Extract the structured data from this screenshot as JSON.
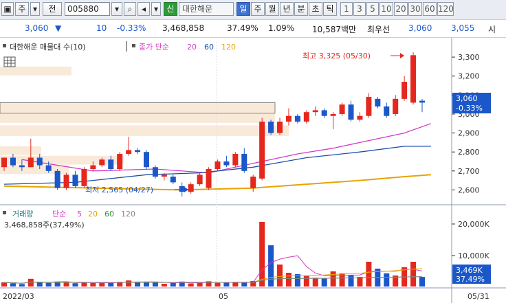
{
  "toolbar": {
    "mode_label": "주",
    "jeon_label": "전",
    "code_value": "005880",
    "shin_label": "신",
    "stock_name": "대한해운",
    "period_tabs": [
      "일",
      "주",
      "월",
      "년",
      "분",
      "초",
      "틱"
    ],
    "interval_tabs": [
      "1",
      "3",
      "5",
      "10",
      "20",
      "30",
      "60",
      "120"
    ],
    "active_period": "일"
  },
  "quote": {
    "price": "3,060",
    "change": "10",
    "change_pct": "-0.33%",
    "volume": "3,468,858",
    "vol_ratio": "37.49%",
    "turnover": "1.09%",
    "amount": "10,587백만",
    "best_label": "최우선",
    "best_sell": "3,060",
    "best_buy": "3,055",
    "extra": "시"
  },
  "price_legend": {
    "title": "대한해운 매물대 수(10)",
    "ma_label": "종가 단순",
    "ma_periods": [
      "20",
      "60",
      "120"
    ]
  },
  "annotations": {
    "high": "최고 3,325 (05/30)",
    "low": "최저 2,565 (04/27)"
  },
  "price_axis": {
    "ticks": [
      "3,300",
      "3,200",
      "3,100",
      "3,000",
      "2,900",
      "2,800",
      "2,700",
      "2,600"
    ],
    "current_price": "3,060",
    "current_pct": "-0.33%"
  },
  "volume_legend": {
    "title": "거래량",
    "ma_label": "단순",
    "ma_periods": [
      "5",
      "20",
      "60",
      "120"
    ],
    "summary": "3,468,858주(37,49%)"
  },
  "volume_axis": {
    "ticks": [
      "20,000K",
      "10,000K"
    ],
    "current_volume": "3,469K",
    "current_pct": "37.49%"
  },
  "date_axis": {
    "labels": [
      "2022/03",
      "05",
      "05/31"
    ]
  },
  "colors": {
    "up": "#e4281e",
    "down": "#1b57c9",
    "ma20": "#d23ac8",
    "ma60": "#1a4fa8",
    "ma120": "#e8a300"
  },
  "chart_data": {
    "type": "candlestick",
    "price_range": [
      2540,
      3380
    ],
    "volume_range": [
      0,
      25000
    ],
    "volume_unit": "K",
    "candles": [
      {
        "o": 2720,
        "h": 2770,
        "l": 2700,
        "c": 2770,
        "v": 1500
      },
      {
        "o": 2770,
        "h": 2790,
        "l": 2720,
        "c": 2730,
        "v": 1200
      },
      {
        "o": 2730,
        "h": 2760,
        "l": 2700,
        "c": 2720,
        "v": 900
      },
      {
        "o": 2720,
        "h": 2870,
        "l": 2720,
        "c": 2770,
        "v": 2800
      },
      {
        "o": 2770,
        "h": 2790,
        "l": 2710,
        "c": 2730,
        "v": 1600
      },
      {
        "o": 2730,
        "h": 2750,
        "l": 2690,
        "c": 2700,
        "v": 1300
      },
      {
        "o": 2700,
        "h": 2710,
        "l": 2600,
        "c": 2610,
        "v": 1800
      },
      {
        "o": 2610,
        "h": 2690,
        "l": 2600,
        "c": 2680,
        "v": 1400
      },
      {
        "o": 2680,
        "h": 2700,
        "l": 2610,
        "c": 2620,
        "v": 1200
      },
      {
        "o": 2620,
        "h": 2720,
        "l": 2610,
        "c": 2710,
        "v": 1500
      },
      {
        "o": 2710,
        "h": 2750,
        "l": 2700,
        "c": 2730,
        "v": 1300
      },
      {
        "o": 2730,
        "h": 2770,
        "l": 2720,
        "c": 2760,
        "v": 1400
      },
      {
        "o": 2760,
        "h": 2780,
        "l": 2700,
        "c": 2710,
        "v": 1500
      },
      {
        "o": 2710,
        "h": 2800,
        "l": 2700,
        "c": 2790,
        "v": 1700
      },
      {
        "o": 2790,
        "h": 2880,
        "l": 2780,
        "c": 2810,
        "v": 2200
      },
      {
        "o": 2810,
        "h": 2820,
        "l": 2790,
        "c": 2800,
        "v": 1400
      },
      {
        "o": 2800,
        "h": 2810,
        "l": 2710,
        "c": 2720,
        "v": 1600
      },
      {
        "o": 2720,
        "h": 2730,
        "l": 2660,
        "c": 2670,
        "v": 1500
      },
      {
        "o": 2670,
        "h": 2690,
        "l": 2650,
        "c": 2680,
        "v": 1000
      },
      {
        "o": 2670,
        "h": 2680,
        "l": 2630,
        "c": 2640,
        "v": 1300
      },
      {
        "o": 2620,
        "h": 2640,
        "l": 2565,
        "c": 2590,
        "v": 1800
      },
      {
        "o": 2590,
        "h": 2640,
        "l": 2580,
        "c": 2630,
        "v": 1100
      },
      {
        "o": 2630,
        "h": 2690,
        "l": 2620,
        "c": 2680,
        "v": 1500
      },
      {
        "o": 2610,
        "h": 2720,
        "l": 2600,
        "c": 2710,
        "v": 1900
      },
      {
        "o": 2710,
        "h": 2760,
        "l": 2700,
        "c": 2750,
        "v": 1300
      },
      {
        "o": 2750,
        "h": 2780,
        "l": 2720,
        "c": 2730,
        "v": 1400
      },
      {
        "o": 2730,
        "h": 2800,
        "l": 2720,
        "c": 2790,
        "v": 1700
      },
      {
        "o": 2790,
        "h": 2820,
        "l": 2690,
        "c": 2700,
        "v": 1400
      },
      {
        "o": 2610,
        "h": 2680,
        "l": 2590,
        "c": 2670,
        "v": 2000
      },
      {
        "o": 2660,
        "h": 2980,
        "l": 2650,
        "c": 2960,
        "v": 23500
      },
      {
        "o": 2960,
        "h": 2970,
        "l": 2890,
        "c": 2900,
        "v": 15000
      },
      {
        "o": 2900,
        "h": 2980,
        "l": 2890,
        "c": 2960,
        "v": 8000
      },
      {
        "o": 2960,
        "h": 3030,
        "l": 2940,
        "c": 2990,
        "v": 5000
      },
      {
        "o": 2990,
        "h": 3000,
        "l": 2950,
        "c": 2960,
        "v": 4500
      },
      {
        "o": 2960,
        "h": 3020,
        "l": 2950,
        "c": 3010,
        "v": 3800
      },
      {
        "o": 3010,
        "h": 3040,
        "l": 2990,
        "c": 3020,
        "v": 3200
      },
      {
        "o": 3020,
        "h": 3030,
        "l": 2980,
        "c": 2990,
        "v": 3000
      },
      {
        "o": 2990,
        "h": 3010,
        "l": 2920,
        "c": 3000,
        "v": 5500
      },
      {
        "o": 3000,
        "h": 3060,
        "l": 2990,
        "c": 3050,
        "v": 4800
      },
      {
        "o": 3050,
        "h": 3070,
        "l": 2960,
        "c": 2970,
        "v": 4200
      },
      {
        "o": 2970,
        "h": 3010,
        "l": 2960,
        "c": 2990,
        "v": 3500
      },
      {
        "o": 2990,
        "h": 3110,
        "l": 2980,
        "c": 3090,
        "v": 9000
      },
      {
        "o": 3080,
        "h": 3090,
        "l": 3030,
        "c": 3040,
        "v": 6500
      },
      {
        "o": 3040,
        "h": 3060,
        "l": 2980,
        "c": 2990,
        "v": 4800
      },
      {
        "o": 3000,
        "h": 3100,
        "l": 2990,
        "c": 3080,
        "v": 4000
      },
      {
        "o": 3080,
        "h": 3200,
        "l": 3070,
        "c": 3170,
        "v": 7000
      },
      {
        "o": 3060,
        "h": 3325,
        "l": 3050,
        "c": 3310,
        "v": 9000
      },
      {
        "o": 3070,
        "h": 3080,
        "l": 3010,
        "c": 3060,
        "v": 3469
      }
    ],
    "ma20": [
      [
        2,
        2760
      ],
      [
        10,
        2700
      ],
      [
        17,
        2710
      ],
      [
        23,
        2690
      ],
      [
        29,
        2750
      ],
      [
        33,
        2790
      ],
      [
        37,
        2820
      ],
      [
        41,
        2860
      ],
      [
        45,
        2900
      ],
      [
        48,
        2950
      ]
    ],
    "ma60": [
      [
        0,
        2630
      ],
      [
        8,
        2640
      ],
      [
        16,
        2680
      ],
      [
        22,
        2690
      ],
      [
        28,
        2720
      ],
      [
        34,
        2770
      ],
      [
        40,
        2800
      ],
      [
        45,
        2830
      ],
      [
        48,
        2830
      ]
    ],
    "ma120": [
      [
        0,
        2620
      ],
      [
        10,
        2610
      ],
      [
        20,
        2600
      ],
      [
        28,
        2610
      ],
      [
        34,
        2630
      ],
      [
        40,
        2650
      ],
      [
        45,
        2670
      ],
      [
        48,
        2680
      ]
    ],
    "supply_zones": [
      {
        "low": 3200,
        "high": 3250,
        "width": 0.26
      },
      {
        "low": 3000,
        "high": 3060,
        "width": 1.0
      },
      {
        "low": 2950,
        "high": 3000,
        "width": 1.0
      },
      {
        "low": 2880,
        "high": 2940,
        "width": 1.05
      },
      {
        "low": 2780,
        "high": 2830,
        "width": 0.15
      },
      {
        "low": 2730,
        "high": 2780,
        "width": 0.45
      },
      {
        "low": 2680,
        "high": 2730,
        "width": 0.25
      }
    ]
  }
}
